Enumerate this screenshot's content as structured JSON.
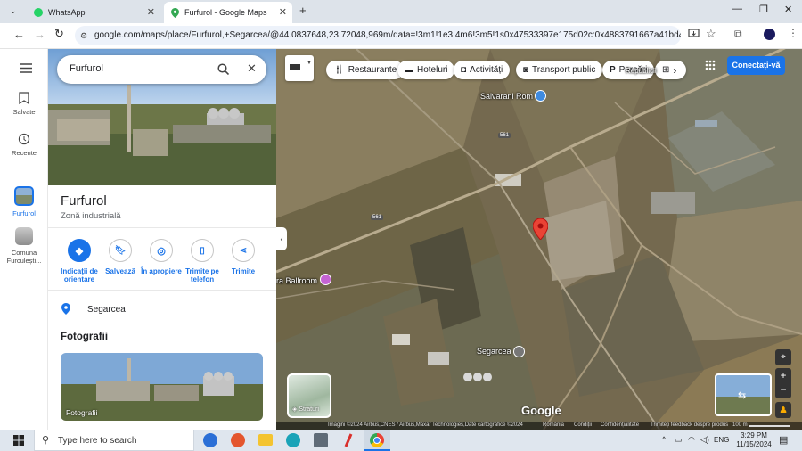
{
  "browser": {
    "tabs": [
      {
        "title": "WhatsApp",
        "icon": "whatsapp-icon"
      },
      {
        "title": "Furfurol - Google Maps",
        "icon": "maps-pin-icon"
      }
    ],
    "url": "google.com/maps/place/Furfurol,+Segarcea/@44.0837648,23.72048,969m/data=!3m1!1e3!4m6!3m5!1s0x47533397e175d02c:0x4883791667a41bd4!8m2!3d44.0837781"
  },
  "search": {
    "value": "Furfurol"
  },
  "rail": {
    "saved": "Salvate",
    "recent": "Recente",
    "current": "Furfurol",
    "comuna": "Comuna Furculești..."
  },
  "place": {
    "name": "Furfurol",
    "category": "Zonă industrială",
    "address": "Segarcea",
    "photos_heading": "Fotografii",
    "photos_label": "Fotografii"
  },
  "actions": [
    {
      "label": "Indicații de orientare"
    },
    {
      "label": "Salvează"
    },
    {
      "label": "În apropiere"
    },
    {
      "label": "Trimite pe telefon"
    },
    {
      "label": "Trimite"
    }
  ],
  "chips": [
    {
      "label": "Restaurante"
    },
    {
      "label": "Hoteluri"
    },
    {
      "label": "Activități"
    },
    {
      "label": "Transport public"
    },
    {
      "label": "Parcări"
    }
  ],
  "account": {
    "signin": "Conectați-vă"
  },
  "map_labels": {
    "salvarani": "Salvarani Rom",
    "ballroom": "ra Ballroom",
    "segarcea": "Segarcea",
    "republicii": "Republicii",
    "road1": "561",
    "road2": "561",
    "logo": "Google",
    "layers": "Straturi"
  },
  "attribution": {
    "imagery": "Imagini ©2024 Airbus,CNES / Airbus,Maxar Technologies,Date cartografice ©2024",
    "country": "România",
    "terms": "Condiții",
    "privacy": "Confidențialitate",
    "feedback": "Trimiteți feedback despre produs",
    "scale": "100 m"
  },
  "taskbar": {
    "search_placeholder": "Type here to search",
    "lang": "ENG",
    "time": "3:29 PM",
    "date": "11/15/2024"
  }
}
